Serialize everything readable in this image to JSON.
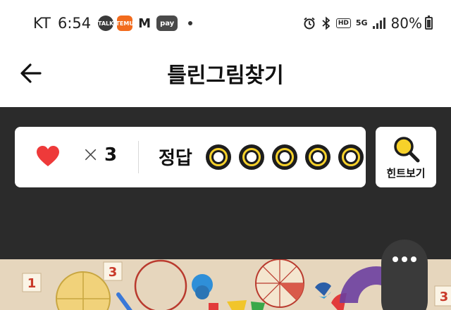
{
  "status_bar": {
    "carrier": "KT",
    "time": "6:54",
    "apps": [
      {
        "icon": "kakaotalk-icon",
        "label": "TALK"
      },
      {
        "icon": "temu-icon",
        "label": "TEMU"
      },
      {
        "icon": "m-app-icon",
        "label": "M"
      },
      {
        "icon": "pay-icon",
        "label": "pay"
      }
    ],
    "network_label": "5G",
    "hd_label": "HD",
    "battery_percent": "80%",
    "battery_level": 0.8
  },
  "app_bar": {
    "title": "틀린그림찾기",
    "back_icon": "back-arrow-icon"
  },
  "score": {
    "times_symbol": "×",
    "lives": "3",
    "answer_label": "정답",
    "answer_total": 5,
    "answer_found": 0,
    "heart_color": "#ee3a3a",
    "slot_color": "#f7d12a"
  },
  "hint": {
    "label": "힌트보기",
    "icon": "magnifier-icon"
  },
  "more_button": {
    "icon": "more-dots-icon"
  },
  "colors": {
    "game_background": "#2b2b2b",
    "accent_yellow": "#f7d12a"
  }
}
